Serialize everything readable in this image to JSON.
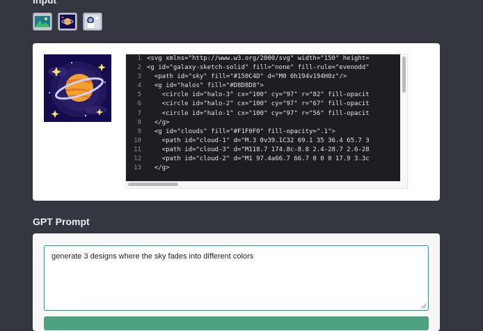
{
  "input_section": {
    "title": "Input",
    "thumbnails": [
      {
        "icon": "landscape-image-icon"
      },
      {
        "icon": "galaxy-image-icon"
      },
      {
        "icon": "astronaut-image-icon"
      }
    ]
  },
  "preview": {
    "icon": "galaxy-planet-illustration"
  },
  "code": {
    "lines": [
      {
        "n": "1",
        "text": "<svg xmlns=\"http://www.w3.org/2000/svg\" width=\"150\" height="
      },
      {
        "n": "2",
        "text": "<g id=\"galaxy-sketch-solid\" fill=\"none\" fill-rule=\"evenodd\""
      },
      {
        "n": "3",
        "text": "  <path id=\"sky\" fill=\"#150C4D\" d=\"M0 0h194v194H0z\"/>"
      },
      {
        "n": "4",
        "text": "  <g id=\"halos\" fill=\"#D8D8D8\">"
      },
      {
        "n": "5",
        "text": "    <circle id=\"halo-3\" cx=\"100\" cy=\"97\" r=\"82\" fill-opacit"
      },
      {
        "n": "6",
        "text": "    <circle id=\"halo-2\" cx=\"100\" cy=\"97\" r=\"67\" fill-opacit"
      },
      {
        "n": "7",
        "text": "    <circle id=\"halo-1\" cx=\"100\" cy=\"97\" r=\"56\" fill-opacit"
      },
      {
        "n": "8",
        "text": "  </g>"
      },
      {
        "n": "9",
        "text": "  <g id=\"clouds\" fill=\"#F1F0F0\" fill-opacity=\".1\">"
      },
      {
        "n": "10",
        "text": "    <path id=\"cloud-1\" d=\"M.3 0v39.1C32 69.1 35 36.4 65.7 3"
      },
      {
        "n": "11",
        "text": "    <path id=\"cloud-3\" d=\"M118.7 174.8c-8.8 2.4-28.7 2.6-28"
      },
      {
        "n": "12",
        "text": "    <path id=\"cloud-2\" d=\"M1 97.4a66.7 66.7 0 0 0 17.9 3.3c"
      },
      {
        "n": "13",
        "text": "  </g>"
      }
    ]
  },
  "prompt_section": {
    "title": "GPT Prompt",
    "value": "generate 3 designs where the sky fades into different colors"
  },
  "colors": {
    "background": "#353740",
    "accent": "#10a37f",
    "button": "#4ea27f",
    "code_bg": "#1e1e22"
  }
}
